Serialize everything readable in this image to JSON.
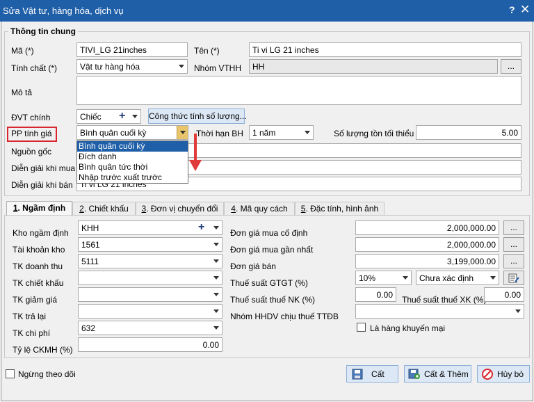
{
  "window": {
    "title": "Sửa Vật tư, hàng hóa, dịch vụ",
    "help": "?",
    "close": "✕"
  },
  "general": {
    "legend": "Thông tin chung",
    "ma_label": "Mã (*)",
    "ma_value": "TIVI_LG 21inches",
    "ten_label": "Tên (*)",
    "ten_value": "Ti vi LG 21 inches",
    "tinhchat_label": "Tính chất (*)",
    "tinhchat_value": "Vật tư hàng hóa",
    "nhom_label": "Nhóm VTHH",
    "nhom_value": "HH",
    "nhom_btn": "...",
    "mota_label": "Mô tả",
    "dvt_label": "ĐVT chính",
    "dvt_value": "Chiếc",
    "congthuc_btn": "Công thức tính số lượng...",
    "pp_label": "PP tính giá",
    "pp_value": "Bình quân cuối kỳ",
    "thoihan_label": "Thời hạn BH",
    "thoihan_value": "1 năm",
    "soluong_label": "Số lượng tồn tối thiểu",
    "soluong_value": "5.00",
    "nguongoc_label": "Nguồn gốc",
    "diengiai_mua_label": "Diễn giải khi mua",
    "diengiai_ban_label": "Diễn giải khi bán",
    "diengiai_ban_value": "Ti vi LG 21 inches"
  },
  "pp_options": [
    "Bình quân cuối kỳ",
    "Đích danh",
    "Bình quân tức thời",
    "Nhập trước xuất trước"
  ],
  "tabs": [
    {
      "num": "1",
      "label": ". Ngầm định"
    },
    {
      "num": "2",
      "label": ". Chiết khấu"
    },
    {
      "num": "3",
      "label": ". Đơn vị chuyển đổi"
    },
    {
      "num": "4",
      "label": ". Mã quy cách"
    },
    {
      "num": "5",
      "label": ". Đặc tính, hình ảnh"
    }
  ],
  "defaults": {
    "kho_label": "Kho ngầm định",
    "kho_value": "KHH",
    "tkkho_label": "Tài khoản kho",
    "tkkho_value": "1561",
    "tkdt_label": "TK doanh thu",
    "tkdt_value": "5111",
    "tkck_label": "TK chiết khấu",
    "tkck_value": "",
    "tkgg_label": "TK giảm giá",
    "tkgg_value": "",
    "tktl_label": "TK trả lại",
    "tktl_value": "",
    "tkcp_label": "TK chi phí",
    "tkcp_value": "632",
    "tyle_label": "Tỷ lệ CKMH (%)",
    "tyle_value": "0.00",
    "dgmcd_label": "Đơn giá mua cố định",
    "dgmcd_value": "2,000,000.00",
    "dgmgn_label": "Đơn giá mua gần nhất",
    "dgmgn_value": "2,000,000.00",
    "dgb_label": "Đơn giá bán",
    "dgb_value": "3,199,000.00",
    "gtgt_label": "Thuế suất GTGT (%)",
    "gtgt_value": "10%",
    "gtgt_type": "Chưa xác định",
    "nk_label": "Thuế suất thuế NK (%)",
    "nk_value": "0.00",
    "xk_label": "Thuế suất thuế XK (%)",
    "xk_value": "0.00",
    "ttdb_label": "Nhóm HHDV chịu thuế TTĐB",
    "km_label": "Là hàng khuyến mại",
    "ellipsis": "..."
  },
  "footer": {
    "ngung_label": "Ngừng theo dõi",
    "cat": "Cất",
    "cat_them": "Cất & Thêm",
    "huy": "Hủy bỏ"
  },
  "colors": {
    "titlebar": "#1f5fa8",
    "highlight": "#d9262e",
    "arrow": "#e03a3a"
  }
}
